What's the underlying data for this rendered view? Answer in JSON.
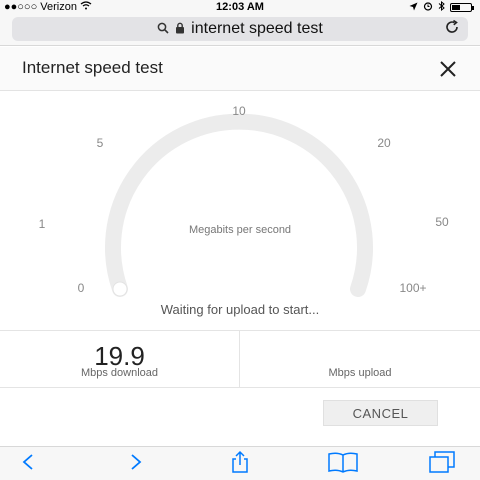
{
  "status_bar": {
    "carrier": "●●○○○ Verizon",
    "time": "12:03 AM"
  },
  "address_bar": {
    "query": "internet speed test"
  },
  "card": {
    "title": "Internet speed test"
  },
  "gauge": {
    "ticks": [
      "0",
      "1",
      "5",
      "10",
      "20",
      "50",
      "100+"
    ],
    "unit": "Megabits per second",
    "status": "Waiting for upload to start...",
    "progress": 0
  },
  "results": {
    "download_value": "19.9",
    "download_label": "Mbps download",
    "upload_value": "",
    "upload_label": "Mbps upload"
  },
  "actions": {
    "cancel": "CANCEL"
  },
  "colors": {
    "accent": "#007aff",
    "track": "#ececec"
  },
  "toolbar_icons": [
    "back-icon",
    "forward-icon",
    "share-icon",
    "bookmarks-icon",
    "tabs-icon"
  ]
}
